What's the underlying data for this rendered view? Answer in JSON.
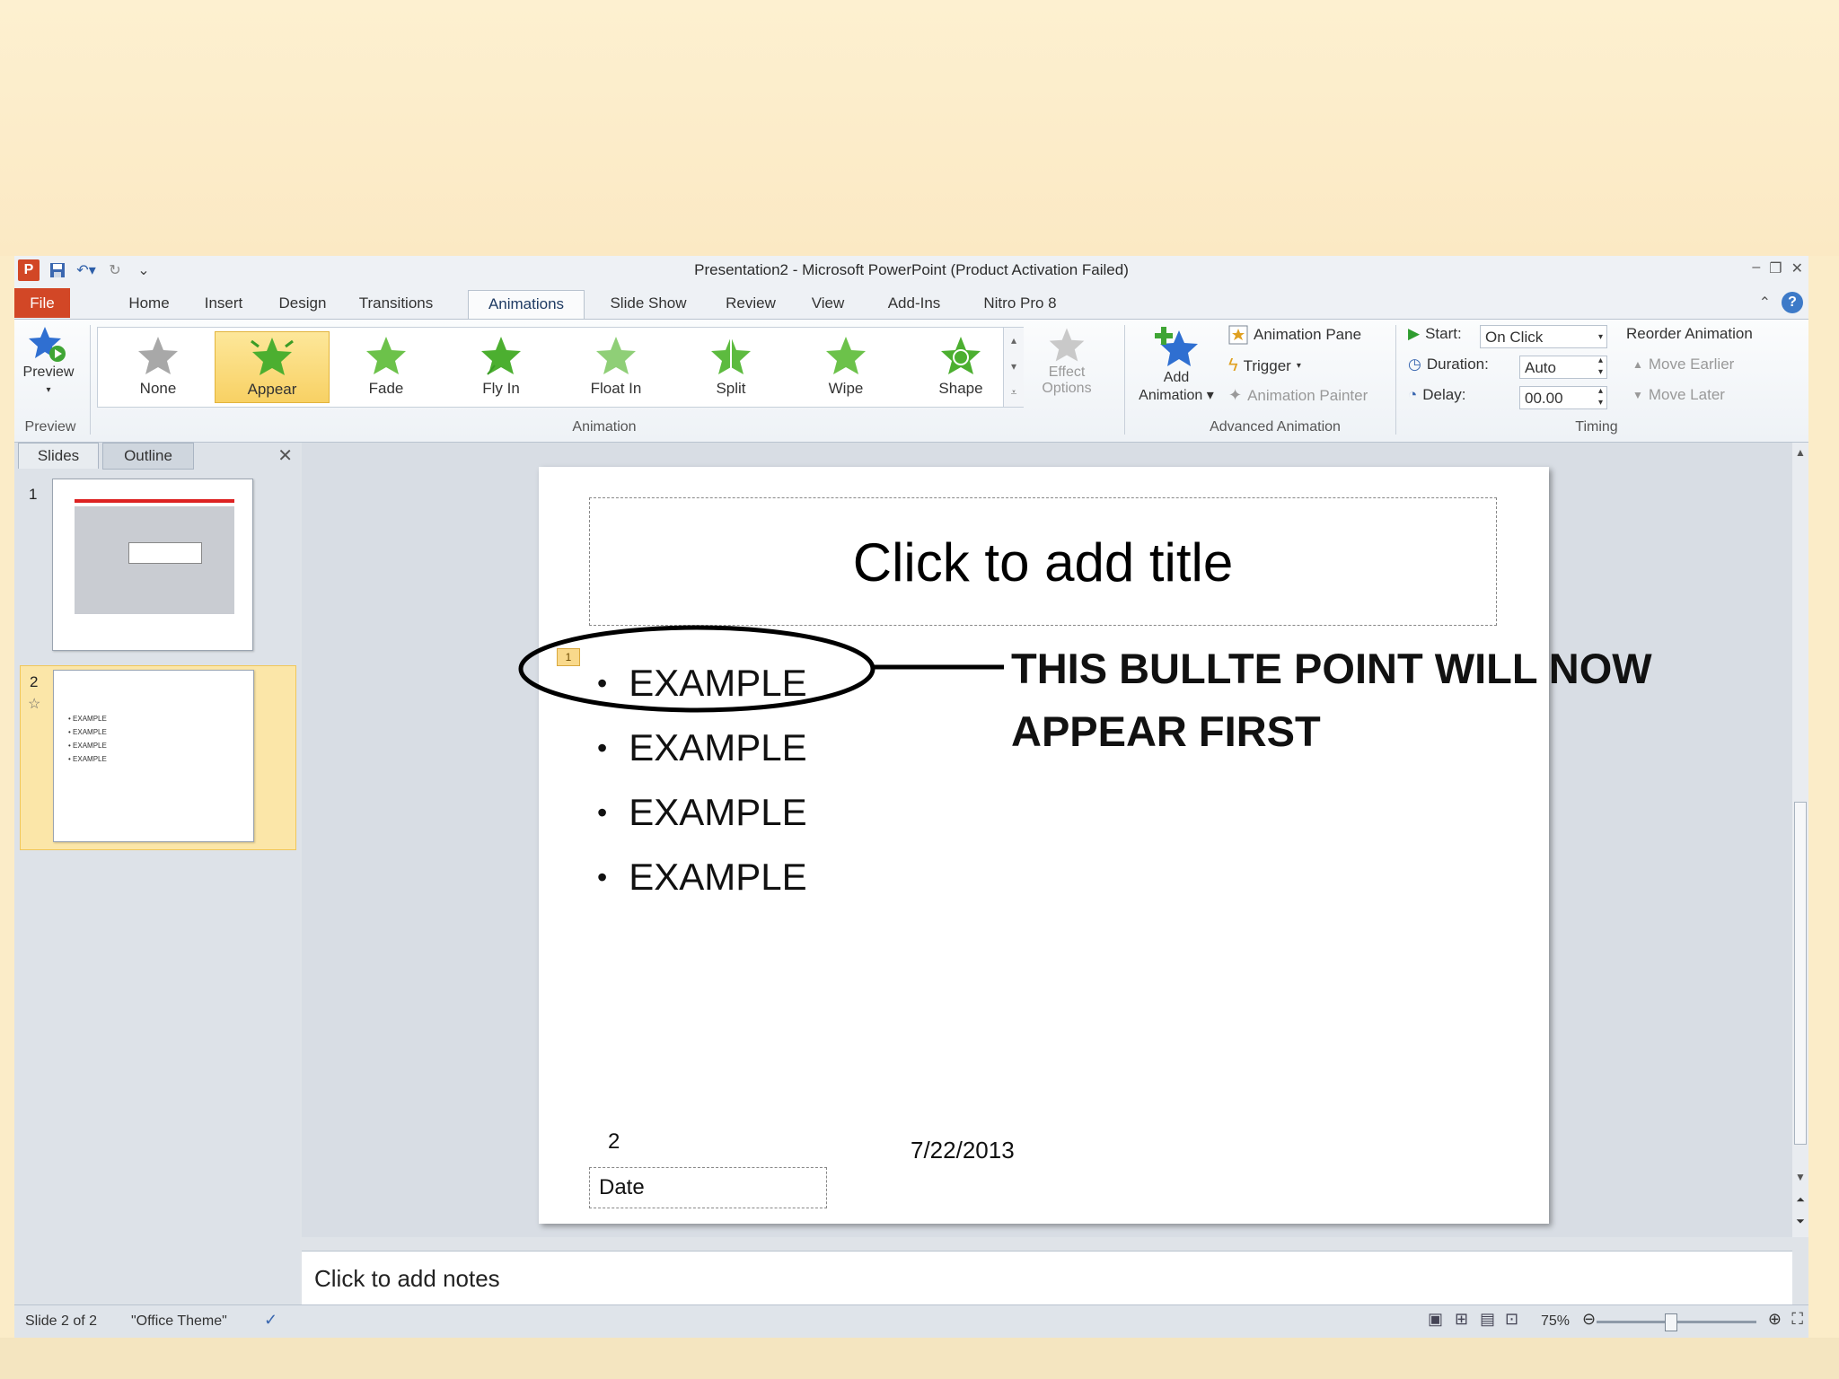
{
  "window": {
    "title": "Presentation2 - Microsoft PowerPoint (Product Activation Failed)"
  },
  "tabs": [
    "File",
    "Home",
    "Insert",
    "Design",
    "Transitions",
    "Animations",
    "Slide Show",
    "Review",
    "View",
    "Add-Ins",
    "Nitro Pro 8"
  ],
  "active_tab": "Animations",
  "ribbon": {
    "preview_label": "Preview",
    "preview_group": "Preview",
    "animation_group": "Animation",
    "animations": [
      "None",
      "Appear",
      "Fade",
      "Fly In",
      "Float In",
      "Split",
      "Wipe",
      "Shape"
    ],
    "selected_animation": "Appear",
    "effect_options": [
      "Effect",
      "Options"
    ],
    "add_animation": [
      "Add",
      "Animation"
    ],
    "advanced_group": "Advanced Animation",
    "animation_pane": "Animation Pane",
    "trigger": "Trigger",
    "animation_painter": "Animation Painter",
    "timing_group": "Timing",
    "start_label": "Start:",
    "start_value": "On Click",
    "duration_label": "Duration:",
    "duration_value": "Auto",
    "delay_label": "Delay:",
    "delay_value": "00.00",
    "reorder_label": "Reorder Animation",
    "move_earlier": "Move Earlier",
    "move_later": "Move Later"
  },
  "left_pane": {
    "tab_slides": "Slides",
    "tab_outline": "Outline",
    "thumbs": [
      {
        "num": "1"
      },
      {
        "num": "2",
        "bullets": [
          "EXAMPLE",
          "EXAMPLE",
          "EXAMPLE",
          "EXAMPLE"
        ]
      }
    ]
  },
  "slide": {
    "title_placeholder": "Click to add title",
    "bullets": [
      "EXAMPLE",
      "EXAMPLE",
      "EXAMPLE",
      "EXAMPLE"
    ],
    "animation_order_tag": "1",
    "slide_number": "2",
    "date_text": "7/22/2013",
    "date_placeholder": "Date"
  },
  "callout": {
    "line1": "THIS BULLTE POINT WILL NOW",
    "line2": "APPEAR FIRST"
  },
  "notes_placeholder": "Click to add notes",
  "status": {
    "slide_info": "Slide 2 of 2",
    "theme": "\"Office Theme\"",
    "zoom": "75%"
  },
  "colors": {
    "file_tab": "#d24726",
    "selected_gallery": "#f8d164",
    "star_green": "#4caf30",
    "star_blue": "#2f6fd1"
  }
}
